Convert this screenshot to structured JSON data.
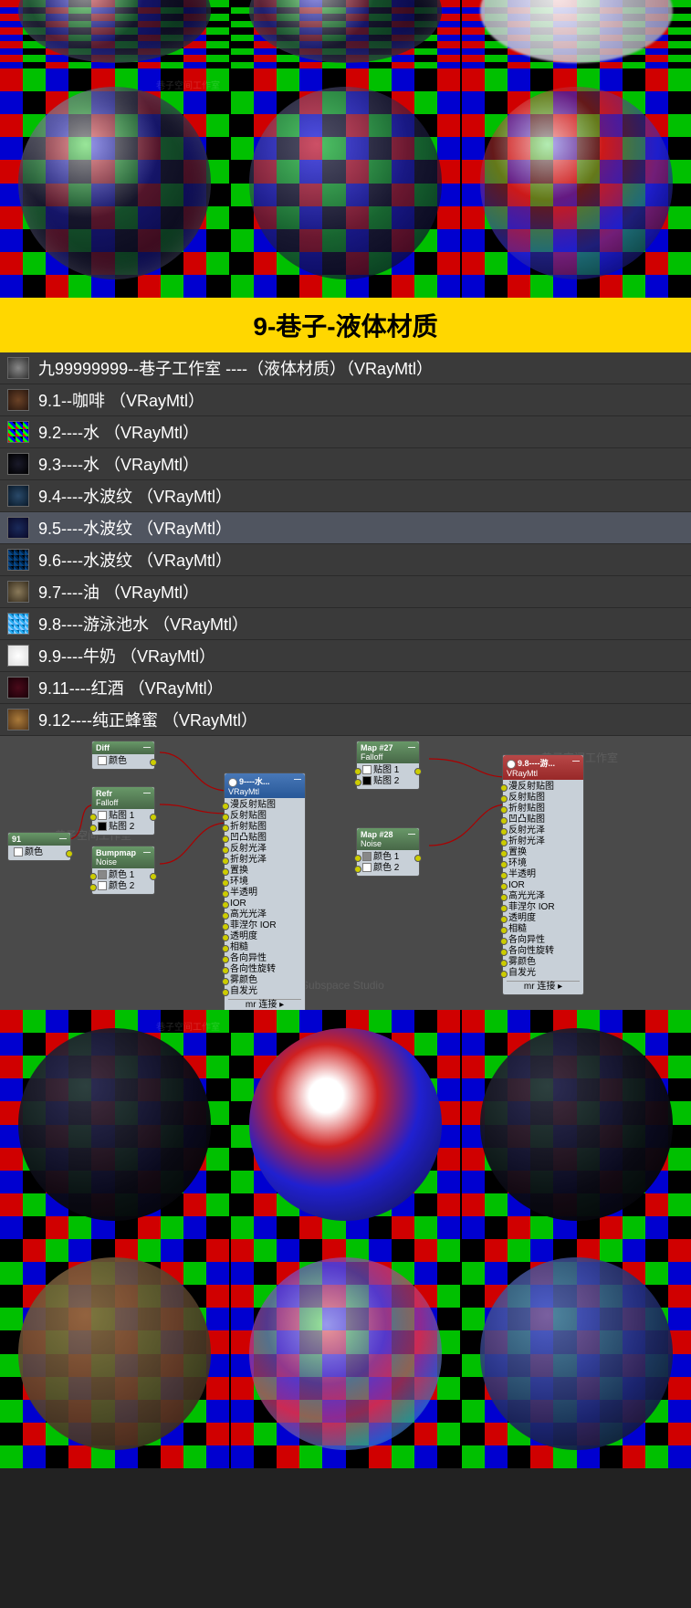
{
  "watermark": {
    "cn": "巷子空间工作室",
    "en": "Lane Subspace Studio"
  },
  "title_bar": "9-巷子-液体材质",
  "materials": [
    {
      "id": "header",
      "label": "九99999999--巷子工作室 ----（液体材质）（VRayMtl）",
      "swatch": "sw-header"
    },
    {
      "id": "coffee",
      "label": "9.1--咖啡 （VRayMtl）",
      "swatch": "sw-coffee"
    },
    {
      "id": "water1",
      "label": "9.2----水 （VRayMtl）",
      "swatch": "sw-water1"
    },
    {
      "id": "water2",
      "label": "9.3----水 （VRayMtl）",
      "swatch": "sw-water2"
    },
    {
      "id": "wave1",
      "label": "9.4----水波纹 （VRayMtl）",
      "swatch": "sw-wave1"
    },
    {
      "id": "wave2",
      "label": "9.5----水波纹 （VRayMtl）",
      "swatch": "sw-wave2",
      "selected": true
    },
    {
      "id": "wave3",
      "label": "9.6----水波纹 （VRayMtl）",
      "swatch": "sw-wave3"
    },
    {
      "id": "oil",
      "label": "9.7----油 （VRayMtl）",
      "swatch": "sw-oil"
    },
    {
      "id": "pool",
      "label": "9.8----游泳池水 （VRayMtl）",
      "swatch": "sw-pool"
    },
    {
      "id": "milk",
      "label": "9.9----牛奶 （VRayMtl）",
      "swatch": "sw-milk"
    },
    {
      "id": "wine",
      "label": "9.11----红酒 （VRayMtl）",
      "swatch": "sw-wine"
    },
    {
      "id": "honey",
      "label": "9.12----纯正蜂蜜 （VRayMtl）",
      "swatch": "sw-honey"
    }
  ],
  "nodes": {
    "color91": {
      "title": "91",
      "row": "颜色"
    },
    "diff": {
      "title": "Diff",
      "row": "颜色"
    },
    "refr": {
      "title": "Refr",
      "sub": "Falloff",
      "rows": [
        "贴图 1",
        "贴图 2"
      ]
    },
    "bump": {
      "title": "Bumpmap",
      "sub": "Noise",
      "rows": [
        "颜色 1",
        "颜色 2"
      ]
    },
    "vray_left": {
      "title": "9----水...",
      "sub": "VRayMtl",
      "rows": [
        "漫反射贴图",
        "反射贴图",
        "折射贴图",
        "凹凸贴图",
        "反射光泽",
        "折射光泽",
        "置换",
        "环境",
        "半透明",
        "IOR",
        "高光光泽",
        "菲涅尔 IOR",
        "透明度",
        "相糙",
        "各向异性",
        "各向性旋转",
        "雾颜色",
        "自发光"
      ],
      "footer": "mr 连接"
    },
    "map27": {
      "title": "Map #27",
      "sub": "Falloff",
      "rows": [
        "贴图 1",
        "贴图 2"
      ]
    },
    "map28": {
      "title": "Map #28",
      "sub": "Noise",
      "rows": [
        "颜色 1",
        "颜色 2"
      ]
    },
    "vray_right": {
      "title": "9.8----游...",
      "sub": "VRayMtl",
      "rows": [
        "漫反射贴图",
        "反射贴图",
        "折射贴图",
        "凹凸贴图",
        "反射光泽",
        "折射光泽",
        "置换",
        "环境",
        "半透明",
        "IOR",
        "高光光泽",
        "菲涅尔 IOR",
        "透明度",
        "相糙",
        "各向异性",
        "各向性旋转",
        "雾颜色",
        "自发光"
      ],
      "footer": "mr 连接"
    }
  }
}
